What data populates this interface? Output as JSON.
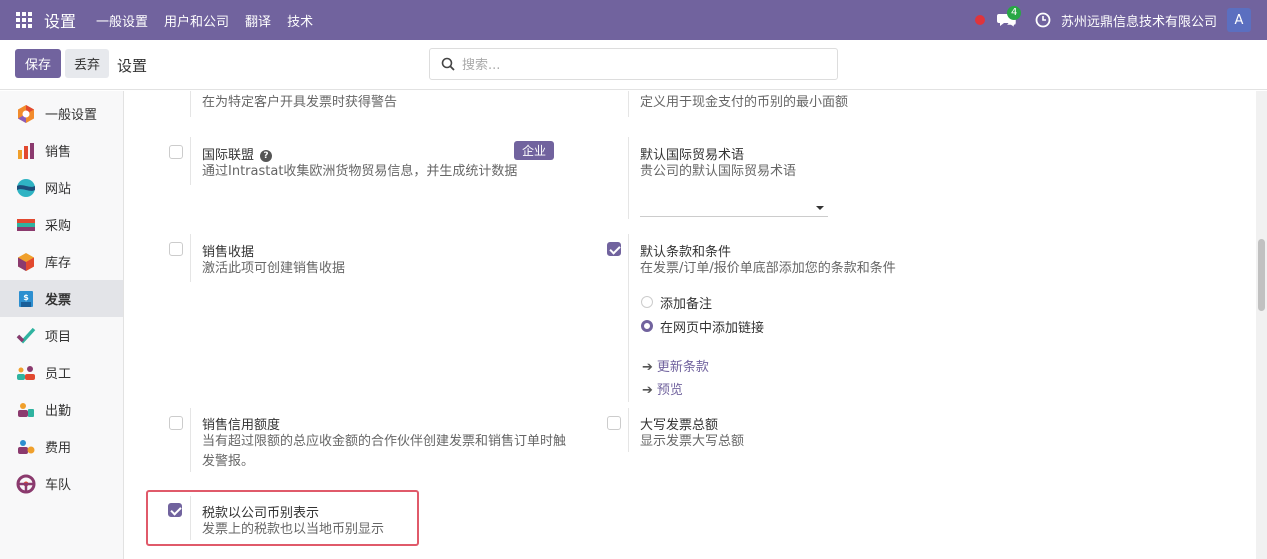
{
  "topbar": {
    "app_title": "设置",
    "nav": [
      "一般设置",
      "用户和公司",
      "翻译",
      "技术"
    ],
    "chat_count": "4",
    "company": "苏州远鼎信息技术有限公司",
    "avatar": "A",
    "brand_color": "#71639e"
  },
  "control": {
    "save_label": "保存",
    "discard_label": "丢弃",
    "breadcrumb": "设置",
    "search_placeholder": "搜索..."
  },
  "sidebar": {
    "items": [
      {
        "label": "一般设置",
        "icon": "general-settings-icon"
      },
      {
        "label": "销售",
        "icon": "sales-icon"
      },
      {
        "label": "网站",
        "icon": "website-icon"
      },
      {
        "label": "采购",
        "icon": "purchase-icon"
      },
      {
        "label": "库存",
        "icon": "inventory-icon"
      },
      {
        "label": "发票",
        "icon": "invoicing-icon",
        "active": true
      },
      {
        "label": "项目",
        "icon": "project-icon"
      },
      {
        "label": "员工",
        "icon": "employees-icon"
      },
      {
        "label": "出勤",
        "icon": "attendance-icon"
      },
      {
        "label": "费用",
        "icon": "expenses-icon"
      },
      {
        "label": "车队",
        "icon": "fleet-icon"
      }
    ]
  },
  "settings": {
    "top_left_desc": "在为特定客户开具发票时获得警告",
    "top_right_desc": "定义用于现金支付的币别的最小面额",
    "intrastat": {
      "title": "国际联盟",
      "desc": "通过Intrastat收集欧洲货物贸易信息，并生成统计数据",
      "tag": "企业",
      "checked": false
    },
    "incoterm": {
      "title": "默认国际贸易术语",
      "desc": "贵公司的默认国际贸易术语",
      "value": ""
    },
    "sale_receipts": {
      "title": "销售收据",
      "desc": "激活此项可创建销售收据",
      "checked": false
    },
    "terms": {
      "title": "默认条款和条件",
      "desc": "在发票/订单/报价单底部添加您的条款和条件",
      "checked": true,
      "options": [
        "添加备注",
        "在网页中添加链接"
      ],
      "selected": 1,
      "links": [
        "更新条款",
        "预览"
      ]
    },
    "credit_limit": {
      "title": "销售信用额度",
      "desc": "当有超过限额的总应收金额的合作伙伴创建发票和销售订单时触发警报。",
      "checked": false
    },
    "amount_in_words": {
      "title": "大写发票总额",
      "desc": "显示发票大写总额",
      "checked": false
    },
    "tax_company_currency": {
      "title": "税款以公司币别表示",
      "desc": "发票上的税款也以当地币别显示",
      "checked": true
    }
  }
}
